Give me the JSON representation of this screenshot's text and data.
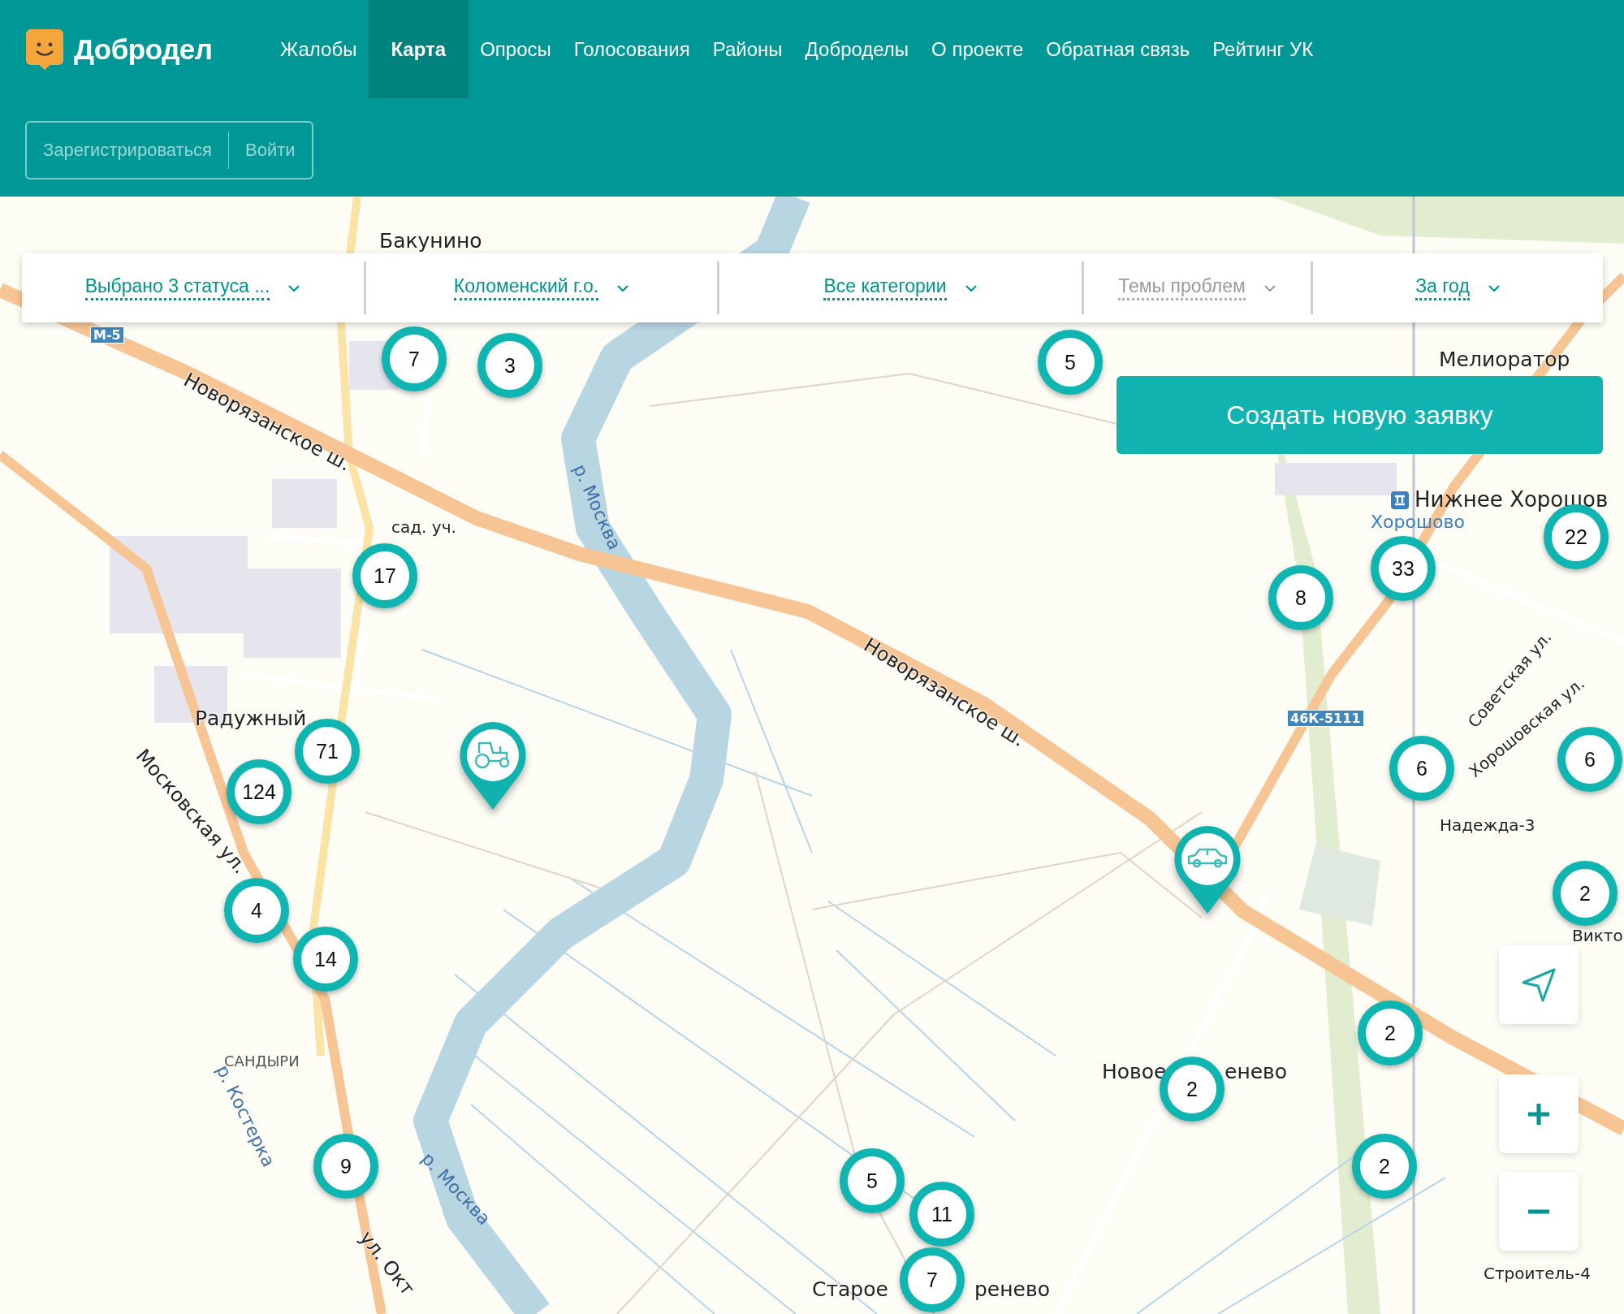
{
  "header": {
    "logo": "Добродел",
    "nav": [
      {
        "label": "Жалобы",
        "selected": false
      },
      {
        "label": "Карта",
        "selected": true
      },
      {
        "label": "Опросы",
        "selected": false
      },
      {
        "label": "Голосования",
        "selected": false
      },
      {
        "label": "Районы",
        "selected": false
      },
      {
        "label": "Доброделы",
        "selected": false
      },
      {
        "label": "О проекте",
        "selected": false
      },
      {
        "label": "Обратная связь",
        "selected": false
      },
      {
        "label": "Рейтинг УК",
        "selected": false
      }
    ],
    "auth": [
      "Зарегистрироваться",
      "Войти"
    ]
  },
  "filters": [
    {
      "label": "Выбрано 3 статуса ...",
      "disabled": false
    },
    {
      "label": "Коломенский г.о.",
      "disabled": false
    },
    {
      "label": "Все категории",
      "disabled": false
    },
    {
      "label": "Темы проблем",
      "disabled": true
    },
    {
      "label": "За год",
      "disabled": false
    }
  ],
  "create_button": "Создать новую заявку",
  "map": {
    "labels": [
      {
        "text": "Бакунино",
        "kind": "place"
      },
      {
        "text": "М-5",
        "kind": "shield"
      },
      {
        "text": "Новорязанское ш.",
        "kind": "road"
      },
      {
        "text": "сад. уч.",
        "kind": "small"
      },
      {
        "text": "р. Москва",
        "kind": "water"
      },
      {
        "text": "Новорязанское ш.",
        "kind": "road"
      },
      {
        "text": "Радужный",
        "kind": "place"
      },
      {
        "text": "Московская ул.",
        "kind": "road"
      },
      {
        "text": "САНДЫРИ",
        "kind": "district"
      },
      {
        "text": "р. Костерка",
        "kind": "water"
      },
      {
        "text": "р. Москва",
        "kind": "water"
      },
      {
        "text": "ул. Окт",
        "kind": "road"
      },
      {
        "text": "Мелиоратор",
        "kind": "place"
      },
      {
        "text": "Нижнее Хорошов",
        "kind": "station"
      },
      {
        "text": "Хорошово",
        "kind": "transit"
      },
      {
        "text": "46К-5111",
        "kind": "shield"
      },
      {
        "text": "Советская ул.",
        "kind": "small"
      },
      {
        "text": "Хорошовская ул.",
        "kind": "small"
      },
      {
        "text": "Надежда-3",
        "kind": "small"
      },
      {
        "text": "Викто",
        "kind": "small"
      },
      {
        "text": "Новое",
        "kind": "place"
      },
      {
        "text": "енево",
        "kind": "place"
      },
      {
        "text": "Старое",
        "kind": "place"
      },
      {
        "text": "ренево",
        "kind": "place"
      },
      {
        "text": "Строитель-4",
        "kind": "small"
      }
    ],
    "clusters": [
      {
        "count": "7"
      },
      {
        "count": "3"
      },
      {
        "count": "5"
      },
      {
        "count": "17"
      },
      {
        "count": "8"
      },
      {
        "count": "33"
      },
      {
        "count": "22"
      },
      {
        "count": "71"
      },
      {
        "count": "124"
      },
      {
        "count": "6"
      },
      {
        "count": "6"
      },
      {
        "count": "4"
      },
      {
        "count": "14"
      },
      {
        "count": "2"
      },
      {
        "count": "2"
      },
      {
        "count": "2"
      },
      {
        "count": "2"
      },
      {
        "count": "9"
      },
      {
        "count": "5"
      },
      {
        "count": "11"
      },
      {
        "count": "7"
      }
    ],
    "pins": [
      {
        "kind": "tractor"
      },
      {
        "kind": "car"
      }
    ]
  }
}
